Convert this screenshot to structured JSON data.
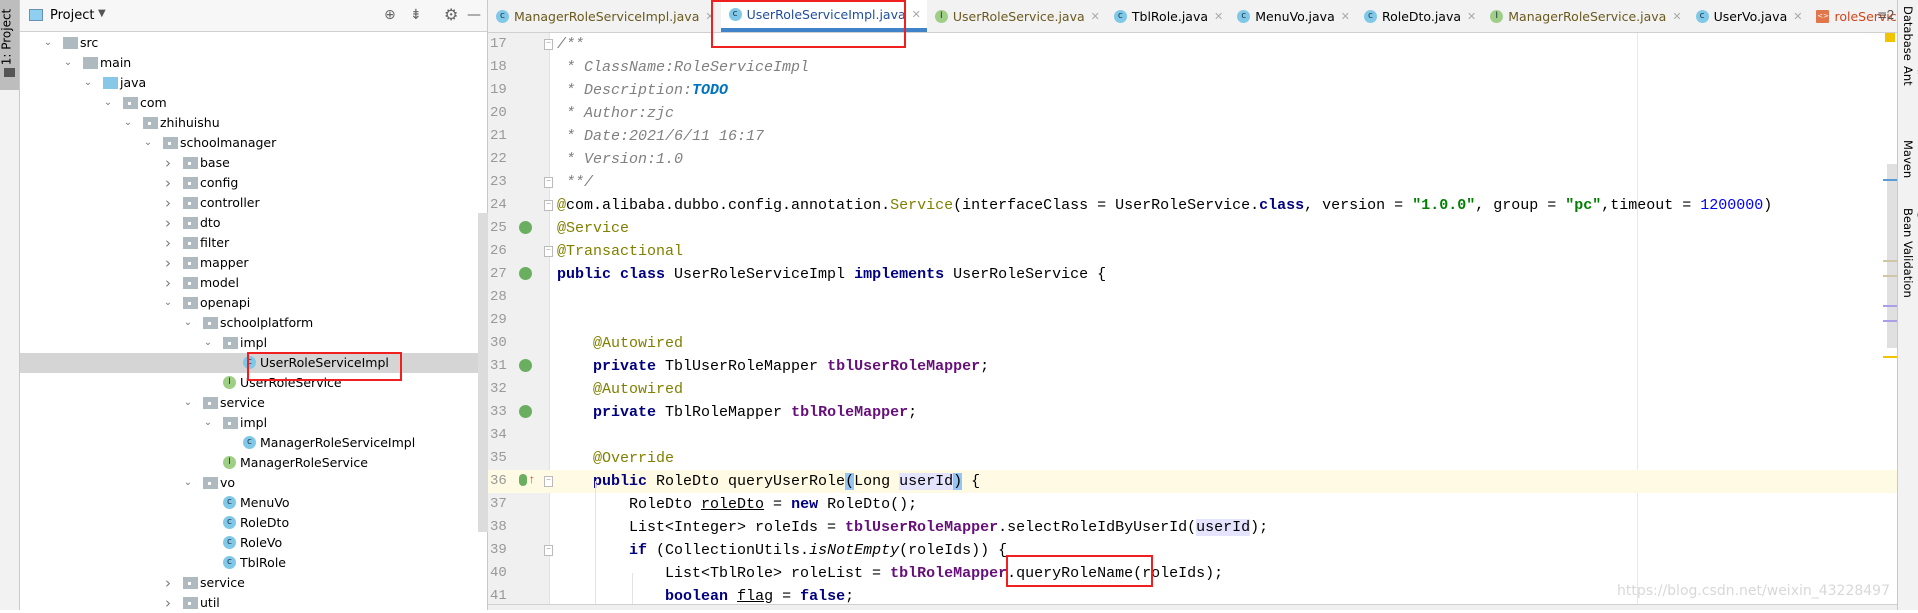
{
  "left_stripe": {
    "project_tab": "1: Project"
  },
  "project_panel": {
    "title": "Project",
    "header_icons": [
      "locate-icon",
      "collapse-all-icon",
      "gear-icon",
      "minimize-icon"
    ],
    "tree": [
      {
        "label": "src",
        "level": 0,
        "type": "folder",
        "expanded": true
      },
      {
        "label": "main",
        "level": 1,
        "type": "folder",
        "expanded": true
      },
      {
        "label": "java",
        "level": 2,
        "type": "java-root",
        "expanded": true
      },
      {
        "label": "com",
        "level": 3,
        "type": "package",
        "expanded": true
      },
      {
        "label": "zhihuishu",
        "level": 4,
        "type": "package",
        "expanded": true
      },
      {
        "label": "schoolmanager",
        "level": 5,
        "type": "package",
        "expanded": true
      },
      {
        "label": "base",
        "level": 6,
        "type": "package",
        "expanded": false
      },
      {
        "label": "config",
        "level": 6,
        "type": "package",
        "expanded": false
      },
      {
        "label": "controller",
        "level": 6,
        "type": "package",
        "expanded": false
      },
      {
        "label": "dto",
        "level": 6,
        "type": "package",
        "expanded": false
      },
      {
        "label": "filter",
        "level": 6,
        "type": "package",
        "expanded": false
      },
      {
        "label": "mapper",
        "level": 6,
        "type": "package",
        "expanded": false
      },
      {
        "label": "model",
        "level": 6,
        "type": "package",
        "expanded": false
      },
      {
        "label": "openapi",
        "level": 6,
        "type": "package",
        "expanded": true
      },
      {
        "label": "schoolplatform",
        "level": 7,
        "type": "package",
        "expanded": true
      },
      {
        "label": "impl",
        "level": 8,
        "type": "package",
        "expanded": true
      },
      {
        "label": "UserRoleServiceImpl",
        "level": 9,
        "type": "class",
        "selected": true
      },
      {
        "label": "UserRoleService",
        "level": 8,
        "type": "interface"
      },
      {
        "label": "service",
        "level": 7,
        "type": "package",
        "expanded": true
      },
      {
        "label": "impl",
        "level": 8,
        "type": "package",
        "expanded": true
      },
      {
        "label": "ManagerRoleServiceImpl",
        "level": 9,
        "type": "class"
      },
      {
        "label": "ManagerRoleService",
        "level": 8,
        "type": "interface"
      },
      {
        "label": "vo",
        "level": 7,
        "type": "package",
        "expanded": true
      },
      {
        "label": "MenuVo",
        "level": 8,
        "type": "class"
      },
      {
        "label": "RoleDto",
        "level": 8,
        "type": "class"
      },
      {
        "label": "RoleVo",
        "level": 8,
        "type": "class"
      },
      {
        "label": "TblRole",
        "level": 8,
        "type": "class"
      },
      {
        "label": "service",
        "level": 6,
        "type": "package",
        "expanded": false
      },
      {
        "label": "util",
        "level": 6,
        "type": "package",
        "expanded": false
      }
    ]
  },
  "tabs": [
    {
      "label": "ManagerRoleServiceImpl.java",
      "icon": "class",
      "color": "#6b5a1e"
    },
    {
      "label": "UserRoleServiceImpl.java",
      "icon": "class",
      "color": "#1f4e9f",
      "active": true
    },
    {
      "label": "UserRoleService.java",
      "icon": "interface",
      "color": "#6b5a1e"
    },
    {
      "label": "TblRole.java",
      "icon": "class",
      "color": "#000000"
    },
    {
      "label": "MenuVo.java",
      "icon": "class",
      "color": "#000000"
    },
    {
      "label": "RoleDto.java",
      "icon": "class",
      "color": "#000000"
    },
    {
      "label": "ManagerRoleService.java",
      "icon": "interface",
      "color": "#6b5a1e"
    },
    {
      "label": "UserVo.java",
      "icon": "class",
      "color": "#000000"
    },
    {
      "label": "roleService.x",
      "icon": "xml",
      "color": "#d0451b"
    }
  ],
  "tab_overflow": "≡2",
  "editor": {
    "current_line": 36,
    "lines": [
      {
        "n": 17,
        "fold": true,
        "tokens": [
          [
            "/**",
            "cm"
          ]
        ]
      },
      {
        "n": 18,
        "tokens": [
          [
            " * ClassName:RoleServiceImpl",
            "cm"
          ]
        ]
      },
      {
        "n": 19,
        "tokens": [
          [
            " * Description:",
            "cm"
          ],
          [
            "TODO",
            "todo"
          ]
        ]
      },
      {
        "n": 20,
        "tokens": [
          [
            " * Author:zjc",
            "cm"
          ]
        ]
      },
      {
        "n": 21,
        "tokens": [
          [
            " * Date:2021/6/11 16:17",
            "cm"
          ]
        ]
      },
      {
        "n": 22,
        "tokens": [
          [
            " * Version:1.0",
            "cm"
          ]
        ]
      },
      {
        "n": 23,
        "fold": true,
        "tokens": [
          [
            " **/",
            "cm"
          ]
        ]
      },
      {
        "n": 24,
        "fold": true,
        "tokens": [
          [
            "@",
            "ann"
          ],
          [
            "com.alibaba.dubbo.config.annotation.",
            ""
          ],
          [
            "Service",
            "ann"
          ],
          [
            "(interfaceClass = UserRoleService.",
            ""
          ],
          [
            "class",
            "kw"
          ],
          [
            ", version = ",
            ""
          ],
          [
            "\"1.0.0\"",
            "str"
          ],
          [
            ", group = ",
            ""
          ],
          [
            "\"pc\"",
            "str"
          ],
          [
            ",timeout = ",
            ""
          ],
          [
            "1200000",
            "num"
          ],
          [
            ")",
            ""
          ]
        ]
      },
      {
        "n": 25,
        "gutter": "bean",
        "tokens": [
          [
            "@Service",
            "ann"
          ]
        ]
      },
      {
        "n": 26,
        "fold": true,
        "tokens": [
          [
            "@Transactional",
            "ann"
          ]
        ]
      },
      {
        "n": 27,
        "gutter": "bean",
        "tokens": [
          [
            "public class",
            "kw"
          ],
          [
            " UserRoleServiceImpl ",
            ""
          ],
          [
            "implements",
            "kw"
          ],
          [
            " UserRoleService {",
            ""
          ]
        ]
      },
      {
        "n": 28,
        "tokens": []
      },
      {
        "n": 29,
        "tokens": []
      },
      {
        "n": 30,
        "tokens": [
          [
            "    ",
            ""
          ],
          [
            "@Autowired",
            "ann"
          ]
        ]
      },
      {
        "n": 31,
        "gutter": "bean",
        "tokens": [
          [
            "    ",
            ""
          ],
          [
            "private",
            "kw"
          ],
          [
            " TblUserRoleMapper ",
            ""
          ],
          [
            "tblUserRoleMapper",
            "fld"
          ],
          [
            ";",
            ""
          ]
        ]
      },
      {
        "n": 32,
        "tokens": [
          [
            "    ",
            ""
          ],
          [
            "@Autowired",
            "ann"
          ]
        ]
      },
      {
        "n": 33,
        "gutter": "bean",
        "tokens": [
          [
            "    ",
            ""
          ],
          [
            "private",
            "kw"
          ],
          [
            " TblRoleMapper ",
            ""
          ],
          [
            "tblRoleMapper",
            "fld"
          ],
          [
            ";",
            ""
          ]
        ]
      },
      {
        "n": 34,
        "tokens": []
      },
      {
        "n": 35,
        "tokens": [
          [
            "    ",
            ""
          ],
          [
            "@Override",
            "ann"
          ]
        ]
      },
      {
        "n": 36,
        "gutter": "override",
        "fold": true,
        "tokens": [
          [
            "    ",
            ""
          ],
          [
            "public",
            "kw"
          ],
          [
            " RoleDto queryUserRole",
            ""
          ],
          [
            "(",
            "hlb"
          ],
          [
            "Long ",
            ""
          ],
          [
            "userId",
            "hlr"
          ],
          [
            ")",
            "hlb"
          ],
          [
            " {",
            ""
          ]
        ]
      },
      {
        "n": 37,
        "tokens": [
          [
            "        RoleDto ",
            ""
          ],
          [
            "roleDto",
            "ul"
          ],
          [
            " = ",
            ""
          ],
          [
            "new",
            "kw"
          ],
          [
            " RoleDto();",
            ""
          ]
        ]
      },
      {
        "n": 38,
        "tokens": [
          [
            "        List<Integer> roleIds = ",
            ""
          ],
          [
            "tblUserRoleMapper",
            "fld"
          ],
          [
            ".selectRoleIdByUserId(",
            ""
          ],
          [
            "userId",
            "hlr"
          ],
          [
            ");",
            ""
          ]
        ]
      },
      {
        "n": 39,
        "fold": true,
        "tokens": [
          [
            "        ",
            ""
          ],
          [
            "if",
            "kw"
          ],
          [
            " (CollectionUtils.",
            ""
          ],
          [
            "isNotEmpty",
            "it"
          ],
          [
            "(roleIds)) {",
            ""
          ]
        ]
      },
      {
        "n": 40,
        "tokens": [
          [
            "            List<TblRole> roleList = ",
            ""
          ],
          [
            "tblRoleMapper",
            "fld"
          ],
          [
            ".queryRoleName(roleIds);",
            ""
          ]
        ]
      },
      {
        "n": 41,
        "tokens": [
          [
            "            ",
            ""
          ],
          [
            "boolean",
            "kw"
          ],
          [
            " ",
            ""
          ],
          [
            "flag",
            "ul"
          ],
          [
            " = ",
            ""
          ],
          [
            "false",
            "kw"
          ],
          [
            ";",
            ""
          ]
        ]
      }
    ]
  },
  "right_stripe": [
    {
      "label": "Database",
      "icon": "database-icon"
    },
    {
      "label": "Ant",
      "icon": "ant-icon"
    },
    {
      "label": "Maven",
      "icon": "maven-icon"
    },
    {
      "label": "Bean Validation",
      "icon": "bean-validation-icon"
    }
  ],
  "watermark": "https://blog.csdn.net/weixin_43228497",
  "colors": {
    "accent": "#4083c9",
    "highlight_box": "#f02020",
    "current_line": "#fffae3",
    "selection": "#d5d5d5"
  }
}
